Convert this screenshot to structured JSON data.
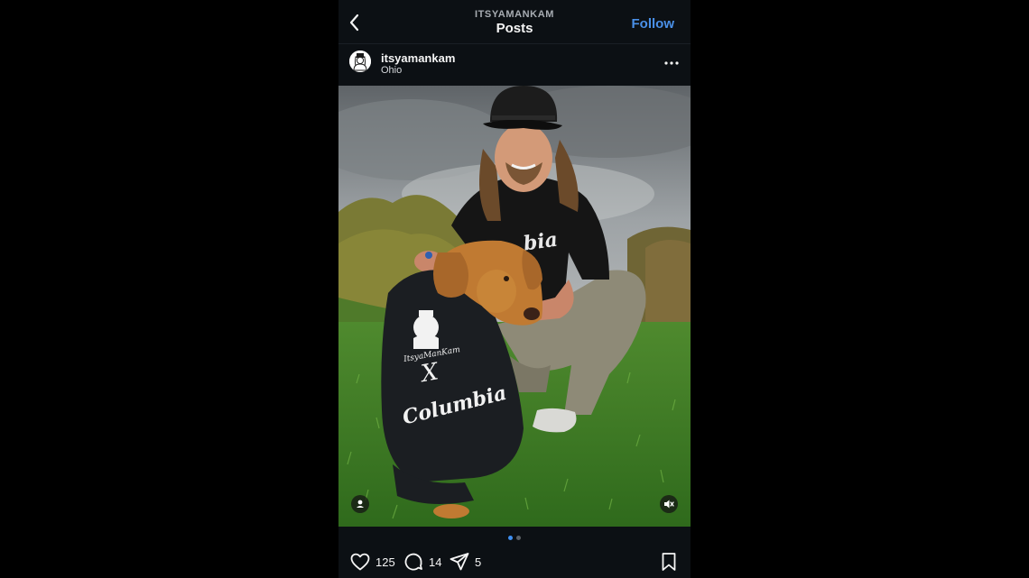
{
  "header": {
    "username": "ITSYAMANKAM",
    "title": "Posts",
    "follow_label": "Follow"
  },
  "post": {
    "username": "itsyamankam",
    "location": "Ohio",
    "shirt_text": "Columbia",
    "dog_shirt_logo": "ItsyaManKam",
    "dog_shirt_x": "X",
    "dog_shirt_brand": "Columbia",
    "carousel": {
      "count": 2,
      "active": 1
    }
  },
  "actions": {
    "likes": "125",
    "comments": "14",
    "shares": "5"
  },
  "icons": {
    "back": "chevron-left-icon",
    "more": "more-horizontal-icon",
    "tag": "user-tag-icon",
    "mute": "muted-speaker-icon",
    "like": "heart-icon",
    "comment": "comment-bubble-icon",
    "share": "paper-plane-icon",
    "save": "bookmark-icon"
  },
  "colors": {
    "background": "#0c1014",
    "accent": "#4a90e8",
    "active_dot": "#3f8ff0"
  }
}
